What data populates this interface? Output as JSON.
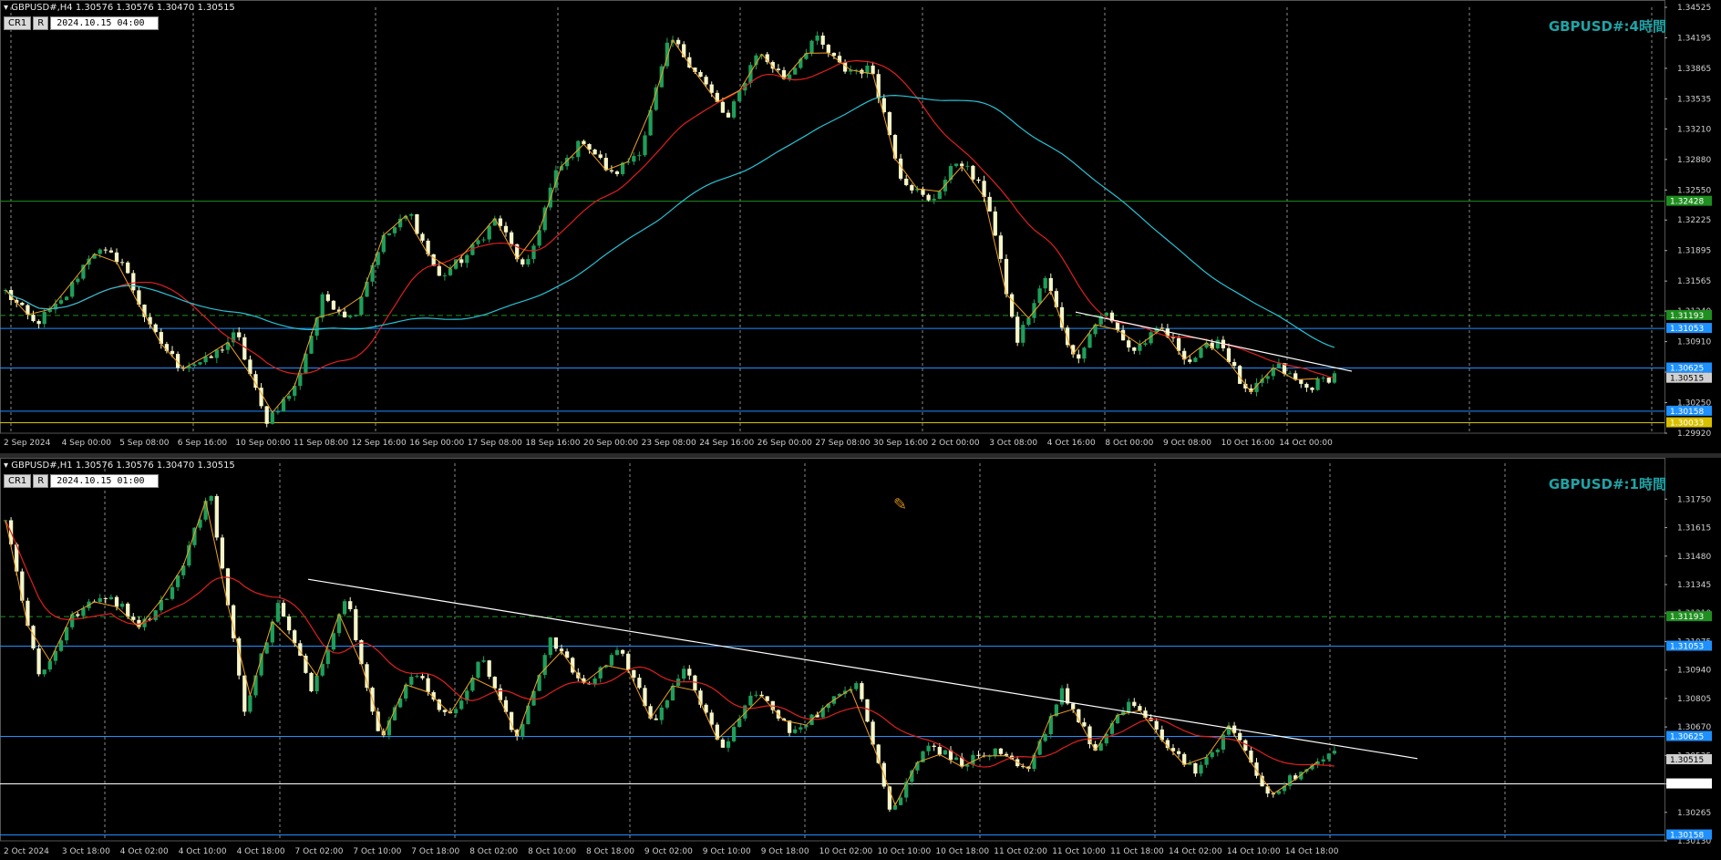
{
  "colors": {
    "background": "#000000",
    "bull_candle": "#1e9e5a",
    "bear_candle": "#f5f5c8",
    "ma_red": "#e01f1f",
    "ma_cyan": "#27c3d6",
    "zigzag": "#f0a020",
    "trendline": "#ffffff",
    "level_blue": "#1e90ff",
    "level_green": "#1f8f1f",
    "level_yellow": "#d8c000",
    "title": "#1fa3a6",
    "grid": "#8a8a8a"
  },
  "icons": {
    "header_arrow": "triangle-down-icon",
    "crosshair": "pencil-cursor-icon"
  },
  "chart_data": [
    {
      "type": "candlestick",
      "header": "GBPUSD#,H4  1.30576 1.30576 1.30470 1.30515",
      "tags": [
        "CR1",
        "R"
      ],
      "cursor_date": "2024.10.15 04:00",
      "title": "GBPUSD#:4時間",
      "ylim": [
        1.2992,
        1.34525
      ],
      "y_ticks": [
        1.34525,
        1.34195,
        1.33865,
        1.33535,
        1.3321,
        1.3288,
        1.3255,
        1.32225,
        1.31895,
        1.31565,
        1.3124,
        1.3091,
        1.3058,
        1.3025,
        1.2992
      ],
      "x_labels": [
        "2 Sep 2024",
        "4 Sep 00:00",
        "5 Sep 08:00",
        "6 Sep 16:00",
        "10 Sep 00:00",
        "11 Sep 08:00",
        "12 Sep 16:00",
        "16 Sep 00:00",
        "17 Sep 08:00",
        "18 Sep 16:00",
        "20 Sep 00:00",
        "23 Sep 08:00",
        "24 Sep 16:00",
        "26 Sep 00:00",
        "27 Sep 08:00",
        "30 Sep 16:00",
        "2 Oct 00:00",
        "3 Oct 08:00",
        "4 Oct 16:00",
        "8 Oct 00:00",
        "9 Oct 08:00",
        "10 Oct 16:00",
        "14 Oct 00:00"
      ],
      "price_keypoints": [
        1.3145,
        1.311,
        1.3135,
        1.319,
        1.318,
        1.3105,
        1.3065,
        1.307,
        1.31,
        1.3005,
        1.304,
        1.314,
        1.3115,
        1.32,
        1.323,
        1.316,
        1.3185,
        1.3225,
        1.3165,
        1.327,
        1.331,
        1.327,
        1.33,
        1.342,
        1.338,
        1.333,
        1.3405,
        1.3375,
        1.342,
        1.3385,
        1.3385,
        1.327,
        1.324,
        1.329,
        1.3245,
        1.309,
        1.316,
        1.307,
        1.3125,
        1.308,
        1.3105,
        1.307,
        1.3095,
        1.303,
        1.3065,
        1.304,
        1.3055
      ],
      "levels": [
        {
          "label": "1.32428",
          "value": 1.32428,
          "color": "#1f8f1f",
          "style": "solid"
        },
        {
          "label": "1.31193",
          "value": 1.31193,
          "color": "#1f8f1f",
          "style": "dashed"
        },
        {
          "label": "1.31053",
          "value": 1.31053,
          "color": "#1e90ff",
          "style": "solid"
        },
        {
          "label": "1.30625",
          "value": 1.30625,
          "color": "#1e90ff",
          "style": "solid"
        },
        {
          "label": "1.30515",
          "value": 1.30515,
          "color": "#cccccc",
          "style": "price"
        },
        {
          "label": "1.30158",
          "value": 1.30158,
          "color": "#1e90ff",
          "style": "solid"
        },
        {
          "label": "1.30033",
          "value": 1.30033,
          "color": "#d8c000",
          "style": "solid"
        }
      ]
    },
    {
      "type": "candlestick",
      "header": "GBPUSD#,H1  1.30576 1.30576 1.30470 1.30515",
      "tags": [
        "CR1",
        "R"
      ],
      "cursor_date": "2024.10.15 01:00",
      "title": "GBPUSD#:1時間",
      "ylim": [
        1.3013,
        1.3192
      ],
      "y_ticks": [
        1.3175,
        1.31615,
        1.3148,
        1.31345,
        1.3121,
        1.31075,
        1.3094,
        1.30805,
        1.3067,
        1.30535,
        1.304,
        1.30265,
        1.3013
      ],
      "x_labels": [
        "2 Oct 2024",
        "3 Oct 18:00",
        "4 Oct 02:00",
        "4 Oct 10:00",
        "4 Oct 18:00",
        "7 Oct 02:00",
        "7 Oct 10:00",
        "7 Oct 18:00",
        "8 Oct 02:00",
        "8 Oct 10:00",
        "8 Oct 18:00",
        "9 Oct 02:00",
        "9 Oct 10:00",
        "9 Oct 18:00",
        "10 Oct 02:00",
        "10 Oct 10:00",
        "10 Oct 18:00",
        "11 Oct 02:00",
        "11 Oct 10:00",
        "11 Oct 18:00",
        "14 Oct 02:00",
        "14 Oct 10:00",
        "14 Oct 18:00"
      ],
      "price_keypoints": [
        1.3165,
        1.309,
        1.312,
        1.313,
        1.3115,
        1.3135,
        1.318,
        1.3075,
        1.3125,
        1.3085,
        1.313,
        1.306,
        1.3095,
        1.307,
        1.31,
        1.306,
        1.311,
        1.3085,
        1.3105,
        1.307,
        1.3095,
        1.3055,
        1.3085,
        1.3065,
        1.3075,
        1.309,
        1.3025,
        1.306,
        1.305,
        1.3055,
        1.3045,
        1.3085,
        1.3055,
        1.308,
        1.306,
        1.3045,
        1.3068,
        1.3035,
        1.3045,
        1.3055
      ],
      "levels": [
        {
          "label": "1.31193",
          "value": 1.31193,
          "color": "#1f8f1f",
          "style": "dashed"
        },
        {
          "label": "1.31053",
          "value": 1.31053,
          "color": "#1e90ff",
          "style": "solid"
        },
        {
          "label": "1.30625",
          "value": 1.30625,
          "color": "#1e90ff",
          "style": "solid"
        },
        {
          "label": "1.30515",
          "value": 1.30515,
          "color": "#cccccc",
          "style": "price"
        },
        {
          "label": "1.30400",
          "value": 1.304,
          "color": "#ffffff",
          "style": "solid"
        },
        {
          "label": "1.30158",
          "value": 1.30158,
          "color": "#1e90ff",
          "style": "solid"
        }
      ]
    }
  ]
}
